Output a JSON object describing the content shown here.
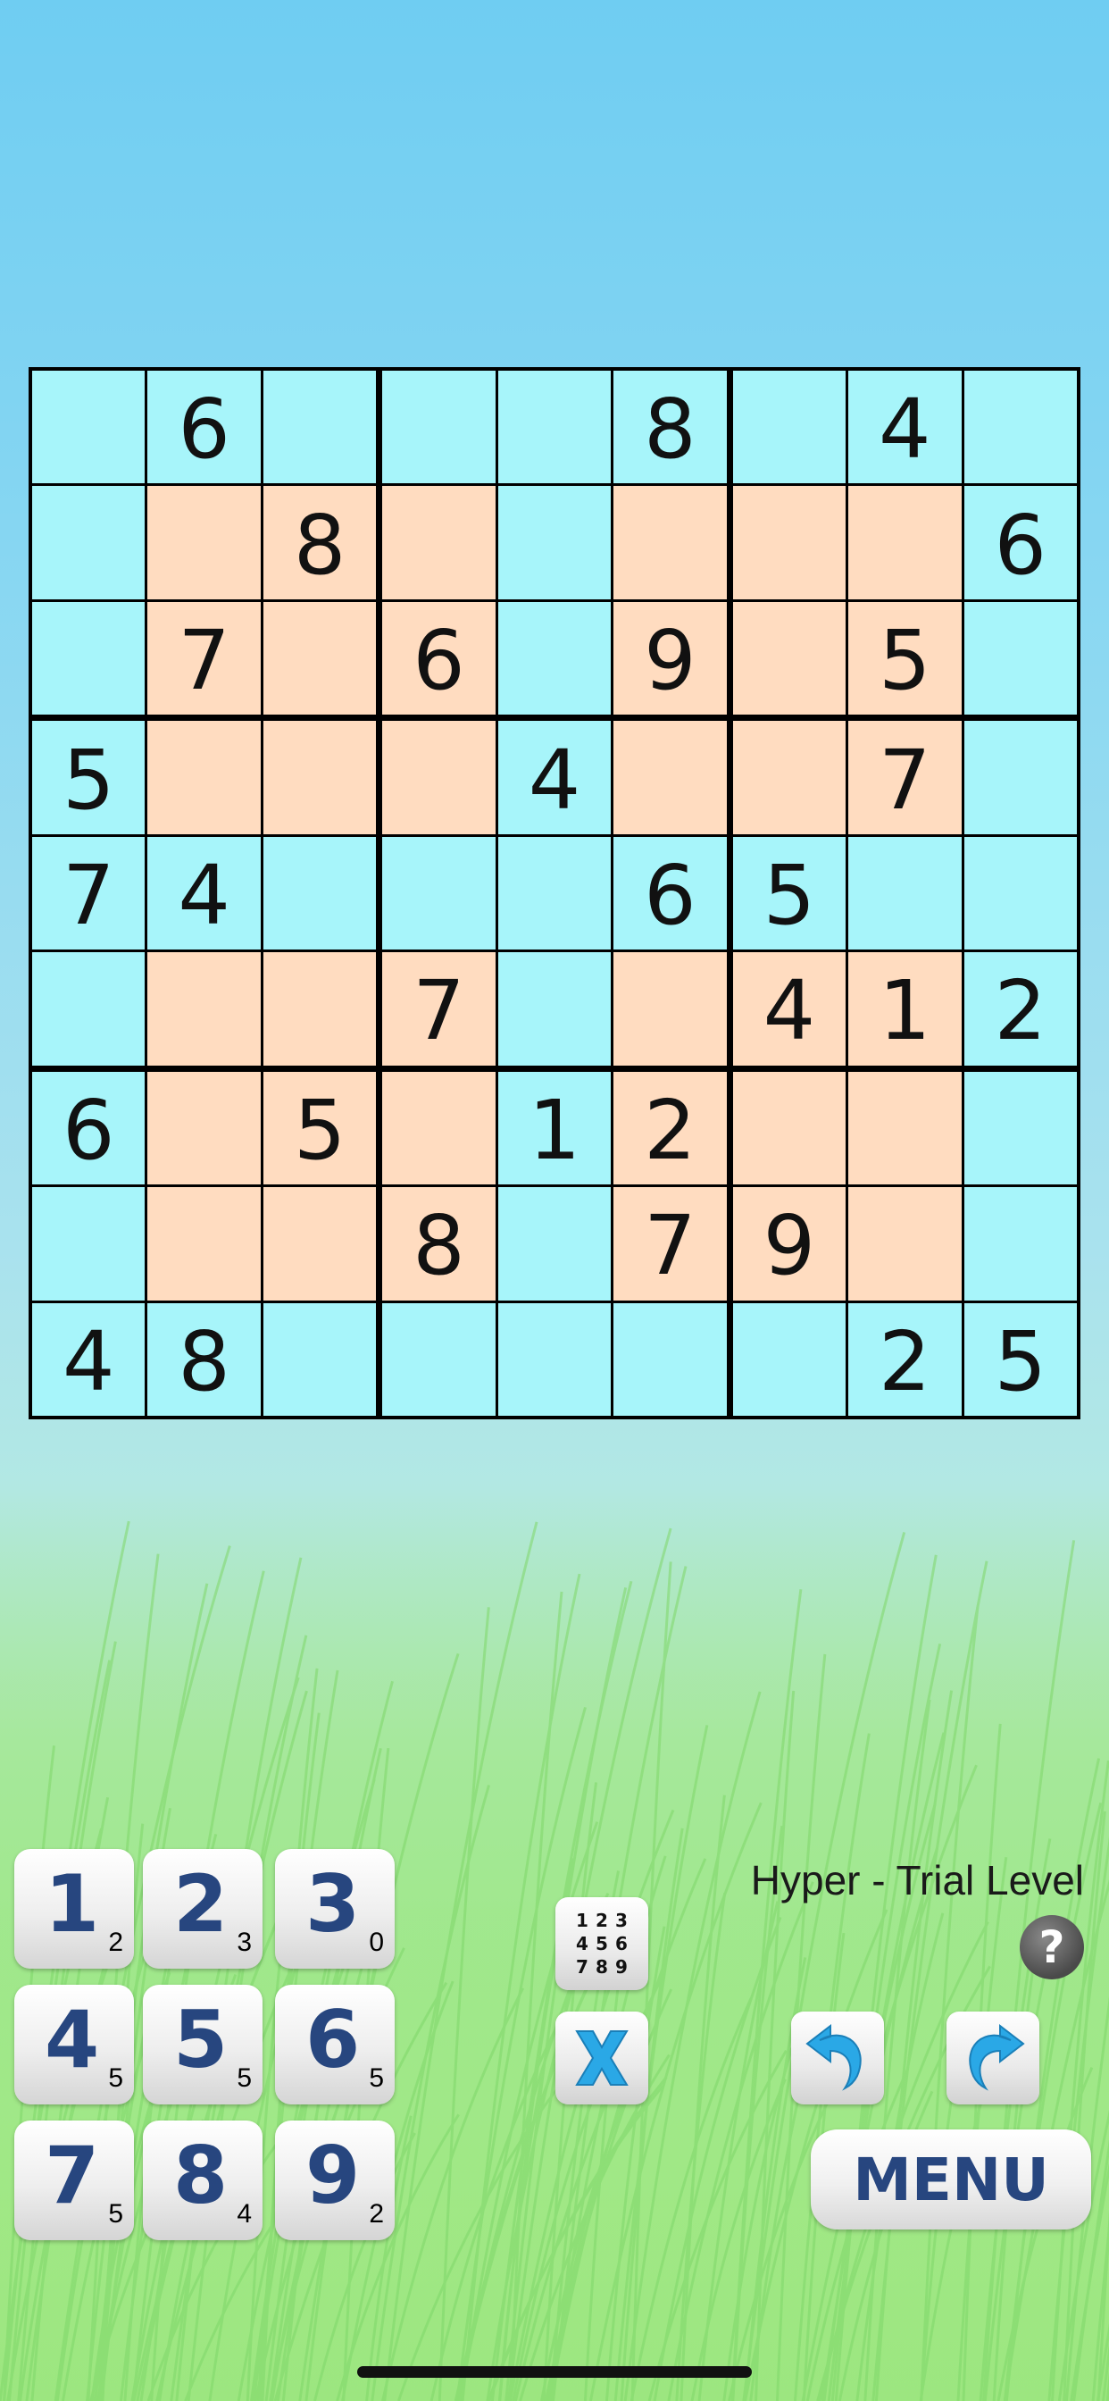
{
  "board": [
    [
      null,
      6,
      null,
      null,
      null,
      8,
      null,
      4,
      null
    ],
    [
      null,
      null,
      8,
      null,
      null,
      null,
      null,
      null,
      6
    ],
    [
      null,
      7,
      null,
      6,
      null,
      9,
      null,
      5,
      null
    ],
    [
      5,
      null,
      null,
      null,
      4,
      null,
      null,
      7,
      null
    ],
    [
      7,
      4,
      null,
      null,
      null,
      6,
      5,
      null,
      null
    ],
    [
      null,
      null,
      null,
      7,
      null,
      null,
      4,
      1,
      2
    ],
    [
      6,
      null,
      5,
      null,
      1,
      2,
      null,
      null,
      null
    ],
    [
      null,
      null,
      null,
      8,
      null,
      7,
      9,
      null,
      null
    ],
    [
      4,
      8,
      null,
      null,
      null,
      null,
      null,
      2,
      5
    ]
  ],
  "highlight_regions": "hyper",
  "colors": {
    "cell_normal": "#a7f5fa",
    "cell_highlight": "#ffdcc0",
    "grid_line": "#000000",
    "digit_key_text": "#27467f"
  },
  "number_pad": [
    {
      "digit": "1",
      "count": "2"
    },
    {
      "digit": "2",
      "count": "3"
    },
    {
      "digit": "3",
      "count": "0"
    },
    {
      "digit": "4",
      "count": "5"
    },
    {
      "digit": "5",
      "count": "5"
    },
    {
      "digit": "6",
      "count": "5"
    },
    {
      "digit": "7",
      "count": "5"
    },
    {
      "digit": "8",
      "count": "4"
    },
    {
      "digit": "9",
      "count": "2"
    }
  ],
  "tools": {
    "pencil_grid": [
      "1",
      "2",
      "3",
      "4",
      "5",
      "6",
      "7",
      "8",
      "9"
    ],
    "erase_icon": "x-erase-icon",
    "undo_icon": "undo-arrow-icon",
    "redo_icon": "redo-arrow-icon"
  },
  "level_label": "Hyper - Trial Level",
  "help_label": "?",
  "menu_label": "MENU"
}
